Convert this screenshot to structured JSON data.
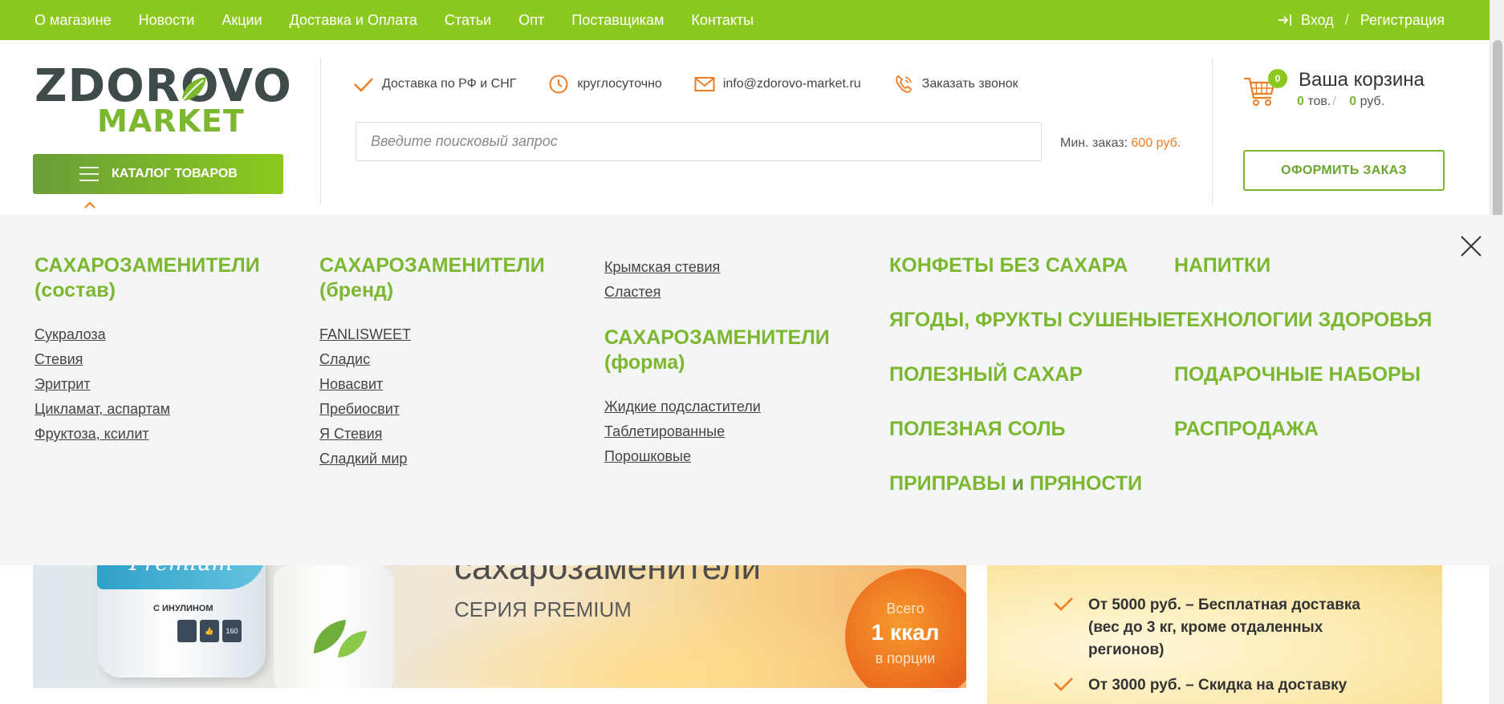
{
  "topnav": {
    "links": [
      "О магазине",
      "Новости",
      "Акции",
      "Доставка и Оплата",
      "Статьи",
      "Опт",
      "Поставщикам",
      "Контакты"
    ],
    "login": "Вход",
    "separator": "/",
    "register": "Регистрация"
  },
  "logo": {
    "line1": "ZDOROVO",
    "line2": "MARKET"
  },
  "catalog_button": "КАТАЛОГ ТОВАРОВ",
  "info": {
    "delivery": "Доставка по РФ и СНГ",
    "hours": "круглосуточно",
    "email": "info@zdorovo-market.ru",
    "callback": "Заказать звонок"
  },
  "search": {
    "placeholder": "Введите поисковый запрос"
  },
  "min_order": {
    "label": "Мин. заказ:",
    "value": "600 руб."
  },
  "cart": {
    "badge": "0",
    "title": "Ваша корзина",
    "items_count": "0",
    "items_unit": "тов.",
    "sum": "0",
    "sum_unit": "руб.",
    "slash": "/"
  },
  "checkout_button": "ОФОРМИТЬ ЗАКАЗ",
  "menu": {
    "col1": {
      "title_line1": "САХАРОЗАМЕНИТЕЛИ",
      "title_line2": "(состав)",
      "links": [
        "Сукралоза",
        "Стевия",
        "Эритрит",
        "Цикламат, аспартам",
        "Фруктоза, ксилит"
      ]
    },
    "col2": {
      "title_line1": "САХАРОЗАМЕНИТЕЛИ",
      "title_line2": "(бренд)",
      "links": [
        "FANLISWEET",
        "Сладис",
        "Новасвит",
        "Пребиосвит",
        "Я Стевия",
        "Сладкий мир"
      ]
    },
    "col3": {
      "top_links": [
        "Крымская стевия",
        "Сластея"
      ],
      "title_line1": "САХАРОЗАМЕНИТЕЛИ",
      "title_line2": "(форма)",
      "links": [
        "Жидкие подсластители",
        "Таблетированные",
        "Порошковые"
      ]
    },
    "col4": {
      "items": [
        "КОНФЕТЫ БЕЗ САХАРА",
        "ЯГОДЫ, ФРУКТЫ СУШЕНЫЕ",
        "ПОЛЕЗНЫЙ САХАР",
        "ПОЛЕЗНАЯ СОЛЬ"
      ],
      "spices_a": "ПРИПРАВЫ",
      "spices_and": "и",
      "spices_b": "ПРЯНОСТИ"
    },
    "col5": {
      "items": [
        "НАПИТКИ",
        "ТЕХНОЛОГИИ ЗДОРОВЬЯ",
        "ПОДАРОЧНЫЕ НАБОРЫ",
        "РАСПРОДАЖА"
      ]
    }
  },
  "banner": {
    "heading": "сахарозаменители",
    "series": "СЕРИЯ PREMIUM",
    "bottle_label": "Premium",
    "bottle_note": "С ИНУЛИНОМ",
    "icon_count": "160",
    "circle_line1": "Всего",
    "circle_line2": "1 ккал",
    "circle_line3": "в порции"
  },
  "delivery": {
    "item1": "От 5000 руб. – Бесплатная доставка (вес до 3 кг, кроме отдаленных регионов)",
    "item2": "От 3000 руб. – Скидка на доставку"
  },
  "colors": {
    "brand_green": "#8cc91e",
    "heading_green": "#7cb82f",
    "accent_orange": "#ef7d22"
  }
}
